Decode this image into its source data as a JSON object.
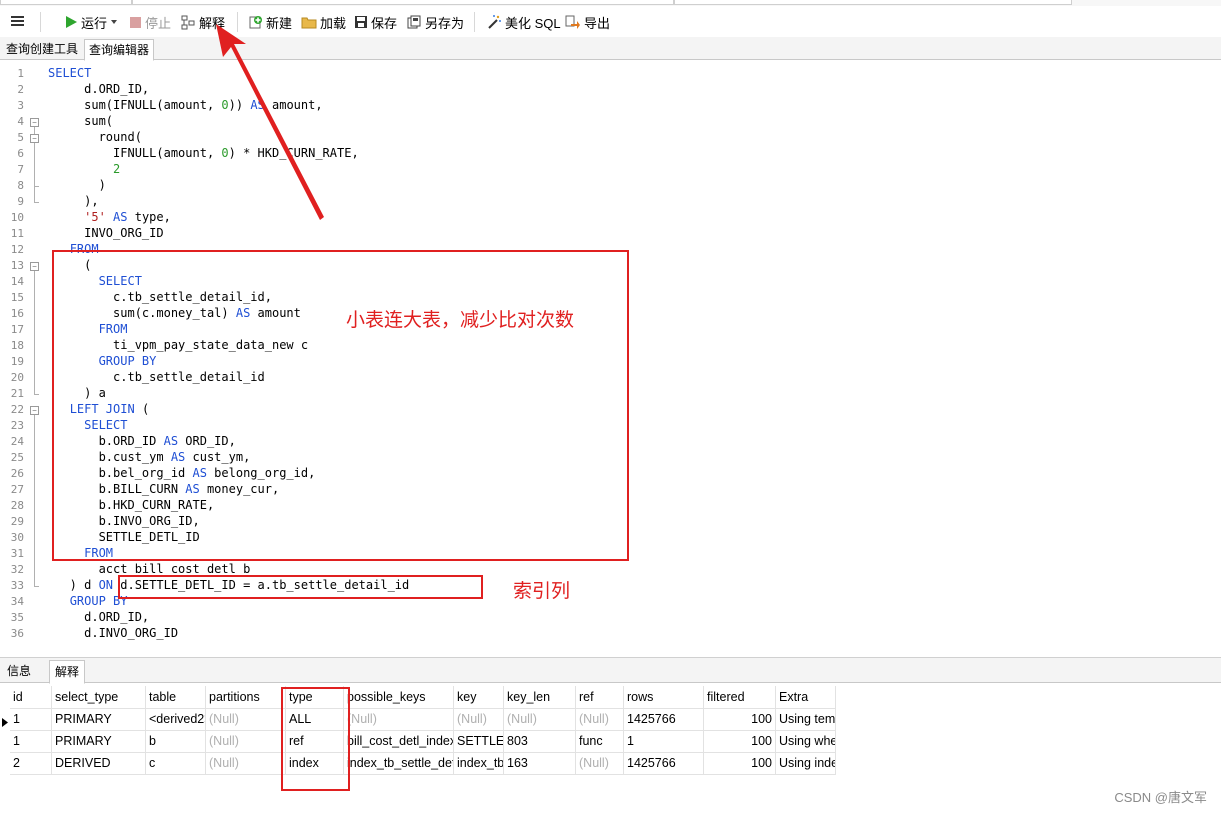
{
  "toolbar": {
    "menu_icon": "hamburger-menu-icon",
    "run": "运行",
    "stop": "停止",
    "explain": "解释",
    "new": "新建",
    "load": "加载",
    "save": "保存",
    "save_as": "另存为",
    "beautify": "美化 SQL",
    "export": "导出"
  },
  "sub_tabs": [
    "查询创建工具",
    "查询编辑器"
  ],
  "editor": {
    "lines": [
      [
        [
          "kw",
          "SELECT"
        ]
      ],
      [
        [
          "t",
          "     d.ORD_ID,"
        ]
      ],
      [
        [
          "t",
          "     sum(IFNULL(amount, "
        ],
        [
          "num",
          "0"
        ],
        [
          "t",
          ")) "
        ],
        [
          "kw",
          "AS"
        ],
        [
          "t",
          " amount,"
        ]
      ],
      [
        [
          "t",
          "     sum("
        ]
      ],
      [
        [
          "t",
          "       round("
        ]
      ],
      [
        [
          "t",
          "         IFNULL(amount, "
        ],
        [
          "num",
          "0"
        ],
        [
          "t",
          ") * HKD_CURN_RATE,"
        ]
      ],
      [
        [
          "t",
          "         "
        ],
        [
          "num",
          "2"
        ]
      ],
      [
        [
          "t",
          "       )"
        ]
      ],
      [
        [
          "t",
          "     ),"
        ]
      ],
      [
        [
          "t",
          "     "
        ],
        [
          "str",
          "'5'"
        ],
        [
          "t",
          " "
        ],
        [
          "kw",
          "AS"
        ],
        [
          "t",
          " type,"
        ]
      ],
      [
        [
          "t",
          "     INVO_ORG_ID"
        ]
      ],
      [
        [
          "t",
          "   "
        ],
        [
          "kw",
          "FROM"
        ]
      ],
      [
        [
          "t",
          "     ("
        ]
      ],
      [
        [
          "t",
          "       "
        ],
        [
          "kw",
          "SELECT"
        ]
      ],
      [
        [
          "t",
          "         c.tb_settle_detail_id,"
        ]
      ],
      [
        [
          "t",
          "         sum(c.money_tal) "
        ],
        [
          "kw",
          "AS"
        ],
        [
          "t",
          " amount"
        ]
      ],
      [
        [
          "t",
          "       "
        ],
        [
          "kw",
          "FROM"
        ]
      ],
      [
        [
          "t",
          "         ti_vpm_pay_state_data_new c"
        ]
      ],
      [
        [
          "t",
          "       "
        ],
        [
          "kw",
          "GROUP BY"
        ]
      ],
      [
        [
          "t",
          "         c.tb_settle_detail_id"
        ]
      ],
      [
        [
          "t",
          "     ) a"
        ]
      ],
      [
        [
          "t",
          "   "
        ],
        [
          "kw",
          "LEFT JOIN"
        ],
        [
          "t",
          " ("
        ]
      ],
      [
        [
          "t",
          "     "
        ],
        [
          "kw",
          "SELECT"
        ]
      ],
      [
        [
          "t",
          "       b.ORD_ID "
        ],
        [
          "kw",
          "AS"
        ],
        [
          "t",
          " ORD_ID,"
        ]
      ],
      [
        [
          "t",
          "       b.cust_ym "
        ],
        [
          "kw",
          "AS"
        ],
        [
          "t",
          " cust_ym,"
        ]
      ],
      [
        [
          "t",
          "       b.bel_org_id "
        ],
        [
          "kw",
          "AS"
        ],
        [
          "t",
          " belong_org_id,"
        ]
      ],
      [
        [
          "t",
          "       b.BILL_CURN "
        ],
        [
          "kw",
          "AS"
        ],
        [
          "t",
          " money_cur,"
        ]
      ],
      [
        [
          "t",
          "       b.HKD_CURN_RATE,"
        ]
      ],
      [
        [
          "t",
          "       b.INVO_ORG_ID,"
        ]
      ],
      [
        [
          "t",
          "       SETTLE_DETL_ID"
        ]
      ],
      [
        [
          "t",
          "     "
        ],
        [
          "kw",
          "FROM"
        ]
      ],
      [
        [
          "t",
          "       acct_bill_cost_detl b"
        ]
      ],
      [
        [
          "t",
          "   ) d "
        ],
        [
          "kw",
          "ON"
        ],
        [
          "t",
          " d.SETTLE_DETL_ID = a.tb_settle_detail_id"
        ]
      ],
      [
        [
          "t",
          "   "
        ],
        [
          "kw",
          "GROUP BY"
        ]
      ],
      [
        [
          "t",
          "     d.ORD_ID,"
        ]
      ],
      [
        [
          "t",
          "     d.INVO_ORG_ID"
        ]
      ]
    ]
  },
  "lower_tabs": [
    "信息",
    "解释"
  ],
  "explain_table": {
    "columns": [
      "id",
      "select_type",
      "table",
      "partitions",
      "type",
      "possible_keys",
      "key",
      "key_len",
      "ref",
      "rows",
      "filtered",
      "Extra"
    ],
    "rows": [
      [
        "1",
        "PRIMARY",
        "<derived2>",
        "(Null)",
        "ALL",
        "(Null)",
        "(Null)",
        "(Null)",
        "(Null)",
        "1425766",
        "100",
        "Using temporary"
      ],
      [
        "1",
        "PRIMARY",
        "b",
        "(Null)",
        "ref",
        "bill_cost_detl_index",
        "SETTLE_DETL_ID",
        "803",
        "func",
        "1",
        "100",
        "Using where"
      ],
      [
        "2",
        "DERIVED",
        "c",
        "(Null)",
        "index",
        "index_tb_settle_detail_id",
        "index_tb_settle_detail_id",
        "163",
        "(Null)",
        "1425766",
        "100",
        "Using index"
      ]
    ]
  },
  "annotations": {
    "small_table_note": "小表连大表，减少比对次数",
    "index_column_note": "索引列"
  },
  "watermark": "CSDN @唐文军",
  "colors": {
    "accent_red": "#e02020",
    "keyword_blue": "#1f4fd4",
    "number_green": "#2a9a2a",
    "string_red": "#b02020"
  }
}
